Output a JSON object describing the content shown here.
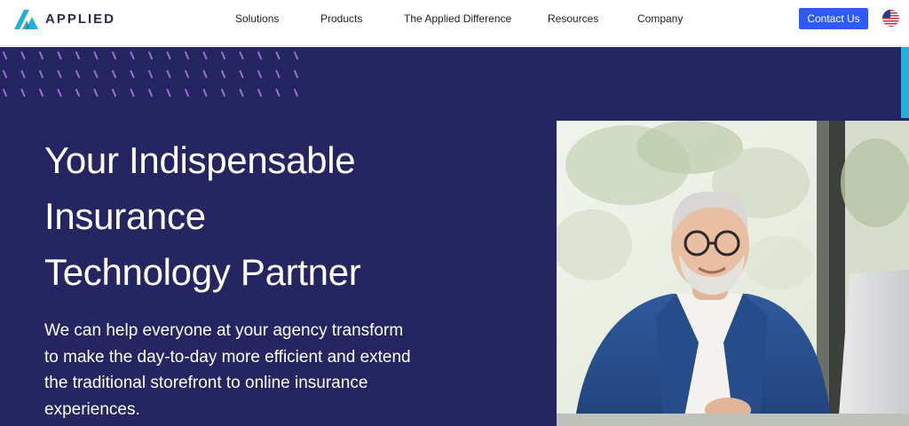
{
  "brand": {
    "name": "APPLIED",
    "accent": "#1fb0dc",
    "navy": "#252561",
    "button_blue": "#2e5bff"
  },
  "nav": {
    "items": [
      {
        "label": "Solutions"
      },
      {
        "label": "Products"
      },
      {
        "label": "The Applied Difference"
      },
      {
        "label": "Resources"
      },
      {
        "label": "Company"
      }
    ],
    "contact_label": "Contact Us",
    "locale_icon": "us-flag-icon"
  },
  "hero": {
    "title_lines": [
      "Your Indispensable",
      "Insurance",
      "Technology Partner"
    ],
    "body": "We can help everyone at your agency transform to make the day-to-day more efficient and extend the traditional storefront to online insurance experiences.",
    "decor_icon": "dash-pattern",
    "image_icon": "smiling-man-laptop-photo"
  }
}
